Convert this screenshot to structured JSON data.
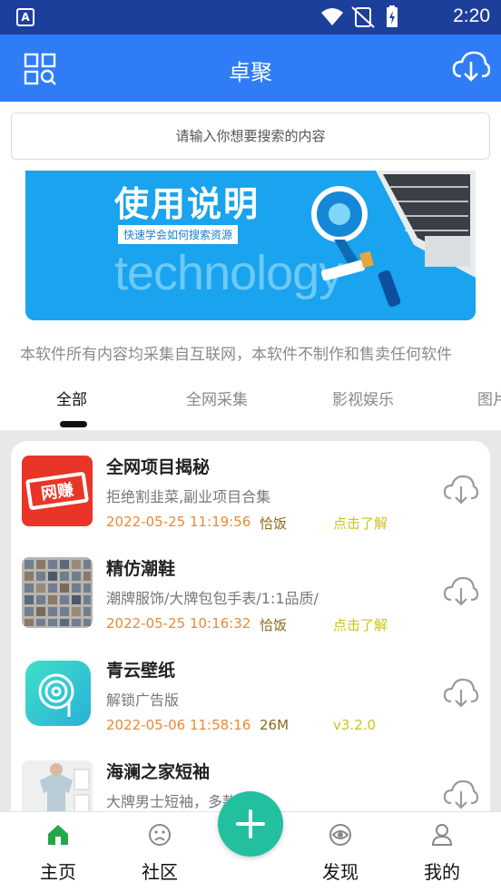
{
  "status_bar": {
    "time": "2:20"
  },
  "header": {
    "title": "卓聚"
  },
  "search": {
    "placeholder": "请输入你想要搜索的内容"
  },
  "banner": {
    "title": "使用说明",
    "subtitle": "快速学会如何搜索资源",
    "word": "technology"
  },
  "notice": "本软件所有内容均采集自互联网，本软件不制作和售卖任何软件",
  "tabs": [
    {
      "label": "全部",
      "active": true
    },
    {
      "label": "全网采集"
    },
    {
      "label": "影视娱乐"
    },
    {
      "label": "图片"
    }
  ],
  "items": [
    {
      "name": "全网项目揭秘",
      "desc": "拒绝割韭菜,副业项目合集",
      "date": "2022-05-25 11:19:56",
      "meta": "恰饭",
      "action": "点击了解",
      "thumb_text": "网赚"
    },
    {
      "name": "精仿潮鞋",
      "desc": "潮牌服饰/大牌包包手表/1:1品质/",
      "date": "2022-05-25 10:16:32",
      "meta": "恰饭",
      "action": "点击了解"
    },
    {
      "name": "青云壁纸",
      "desc": "解锁广告版",
      "date": "2022-05-06 11:58:16",
      "meta": "26M",
      "action": "v3.2.0"
    },
    {
      "name": "海澜之家短袖",
      "desc": "大牌男士短袖，多款可选",
      "date": "",
      "meta": "",
      "action": ""
    }
  ],
  "bottom_nav": [
    {
      "label": "主页",
      "icon": "home-icon"
    },
    {
      "label": "社区",
      "icon": "face-icon"
    },
    {
      "label": "发现",
      "icon": "eye-icon"
    },
    {
      "label": "我的",
      "icon": "user-icon"
    }
  ],
  "colors": {
    "header": "#2f7cf6",
    "statusbar": "#1d3f9c",
    "fab": "#22c09e",
    "date": "#e8893a",
    "action": "#cbc31a"
  }
}
